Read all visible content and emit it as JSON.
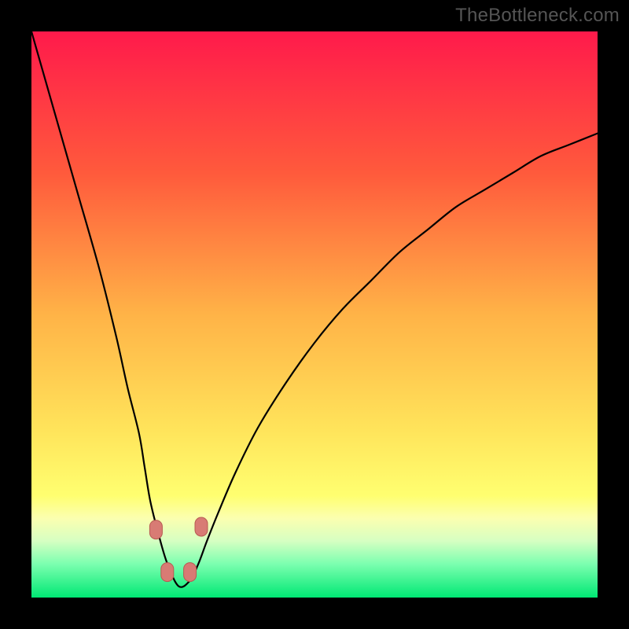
{
  "watermark": "TheBottleneck.com",
  "colors": {
    "background": "#000000",
    "gradient_stops": [
      {
        "offset": 0.0,
        "color": "#ff1a4b"
      },
      {
        "offset": 0.25,
        "color": "#ff5a3c"
      },
      {
        "offset": 0.5,
        "color": "#ffb347"
      },
      {
        "offset": 0.7,
        "color": "#ffe35a"
      },
      {
        "offset": 0.82,
        "color": "#ffff70"
      },
      {
        "offset": 0.86,
        "color": "#fbffb0"
      },
      {
        "offset": 0.9,
        "color": "#d6ffc2"
      },
      {
        "offset": 0.94,
        "color": "#7dffb0"
      },
      {
        "offset": 1.0,
        "color": "#00e874"
      }
    ],
    "curve": "#000000",
    "markers_fill": "#d87b74",
    "markers_stroke": "#b85a52"
  },
  "chart_data": {
    "type": "line",
    "title": "",
    "xlabel": "",
    "ylabel": "",
    "xlim": [
      0,
      100
    ],
    "ylim": [
      0,
      100
    ],
    "minimum_x": 26,
    "series": [
      {
        "name": "bottleneck-curve",
        "x": [
          0,
          4,
          8,
          12,
          15,
          17,
          19,
          20,
          21,
          22.5,
          24,
          26,
          28,
          29.5,
          31,
          33,
          36,
          40,
          45,
          50,
          55,
          60,
          65,
          70,
          75,
          80,
          85,
          90,
          95,
          100
        ],
        "values": [
          100,
          86,
          72,
          58,
          46,
          37,
          29,
          23,
          17,
          11,
          6,
          2,
          3,
          6,
          10,
          15,
          22,
          30,
          38,
          45,
          51,
          56,
          61,
          65,
          69,
          72,
          75,
          78,
          80,
          82
        ]
      }
    ],
    "markers": [
      {
        "x": 22.0,
        "y": 12.0,
        "label": "left-upper-marker"
      },
      {
        "x": 24.0,
        "y": 4.5,
        "label": "left-lower-marker"
      },
      {
        "x": 28.0,
        "y": 4.5,
        "label": "right-lower-marker"
      },
      {
        "x": 30.0,
        "y": 12.5,
        "label": "right-upper-marker"
      }
    ]
  }
}
